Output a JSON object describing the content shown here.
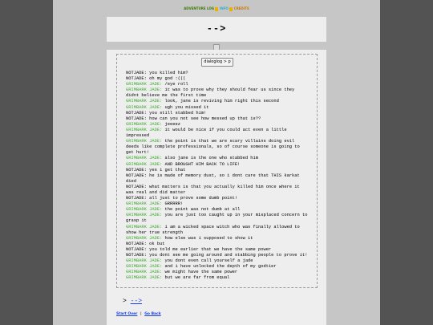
{
  "nav": {
    "items": [
      "ADVENTURE LOG",
      "INFO",
      "CREDITS"
    ]
  },
  "title": "-->",
  "log_button_label": "dialoglog > p",
  "log": [
    {
      "speaker": "NOTJADE:",
      "text": " you killed him?",
      "green": false
    },
    {
      "speaker": "NOTJADE:",
      "text": " oh my god :(((",
      "green": false
    },
    {
      "speaker": "GRIMBARK JADE:",
      "text": " /eye roll",
      "green": true
    },
    {
      "speaker": "GRIMBARK JADE:",
      "text": " it was to prove why they should fear us since they didnt believe me the first time",
      "green": true
    },
    {
      "speaker": "GRIMBARK JADE:",
      "text": " look, jane is reviving him right this second",
      "green": true
    },
    {
      "speaker": "GRIMBARK JADE:",
      "text": " ugh you missed it",
      "green": true
    },
    {
      "speaker": "NOTJADE:",
      "text": " you still stabbed him!",
      "green": false
    },
    {
      "speaker": "NOTJADE:",
      "text": " how can you not see how messed up that is??",
      "green": false
    },
    {
      "speaker": "GRIMBARK JADE:",
      "text": " jeeeez",
      "green": true
    },
    {
      "speaker": "GRIMBARK JADE:",
      "text": " it would be nice if you could act even a little impressed",
      "green": true
    },
    {
      "speaker": "GRIMBARK JADE:",
      "text": " the point is that we are scary villains doing evil deeds like complete professionals, so of course someone is going to get hurt!",
      "green": true
    },
    {
      "speaker": "GRIMBARK JADE:",
      "text": " also jane is the one who stabbed him",
      "green": true
    },
    {
      "speaker": "GRIMBARK JADE:",
      "text": " AND BROUGHT HIM BACK TO LIFE!",
      "green": true
    },
    {
      "speaker": "NOTJADE:",
      "text": " yes i get that",
      "green": false
    },
    {
      "speaker": "NOTJADE:",
      "text": " he is made of memory dust, so i dont care that THIS karkat died",
      "green": false
    },
    {
      "speaker": "NOTJADE:",
      "text": " what matters is that you actually killed him once where it was real and did matter",
      "green": false
    },
    {
      "speaker": "NOTJADE:",
      "text": " all just to prove some dumb point!",
      "green": false
    },
    {
      "speaker": "GRIMBARK JADE:",
      "text": " GRRRRR!",
      "green": true
    },
    {
      "speaker": "GRIMBARK JADE:",
      "text": " the point was not dumb at all",
      "green": true
    },
    {
      "speaker": "GRIMBARK JADE:",
      "text": " you are just too caught up in your misplaced concern to grasp it",
      "green": true
    },
    {
      "speaker": "GRIMBARK JADE:",
      "text": " i am a wicked space witch who was finally allowed to show her true strength",
      "green": true
    },
    {
      "speaker": "GRIMBARK JADE:",
      "text": " how else was i supposed to show it",
      "green": true
    },
    {
      "speaker": "NOTJADE:",
      "text": " ok but",
      "green": false
    },
    {
      "speaker": "NOTJADE:",
      "text": " you told me earlier that we have the same power",
      "green": false
    },
    {
      "speaker": "NOTJADE:",
      "text": " you dont see me going around and stabbing people to prove it!",
      "green": false
    },
    {
      "speaker": "GRIMBARK JADE:",
      "text": " you dont even call yourself a jade",
      "green": true
    },
    {
      "speaker": "GRIMBARK JADE:",
      "text": " and i have unlocked the depth of my godtier",
      "green": true
    },
    {
      "speaker": "GRIMBARK JADE:",
      "text": " we might have the same power",
      "green": true
    },
    {
      "speaker": "GRIMBARK JADE:",
      "text": " but we are far from equal",
      "green": true
    }
  ],
  "next": {
    "prefix": ">",
    "link": "-->"
  },
  "bottom": {
    "start_over": "Start Over",
    "sep": "|",
    "go_back": "Go Back"
  },
  "colors": {
    "green_speaker": "#3dac2d",
    "link": "#1a3fe8",
    "background": "#535353"
  }
}
